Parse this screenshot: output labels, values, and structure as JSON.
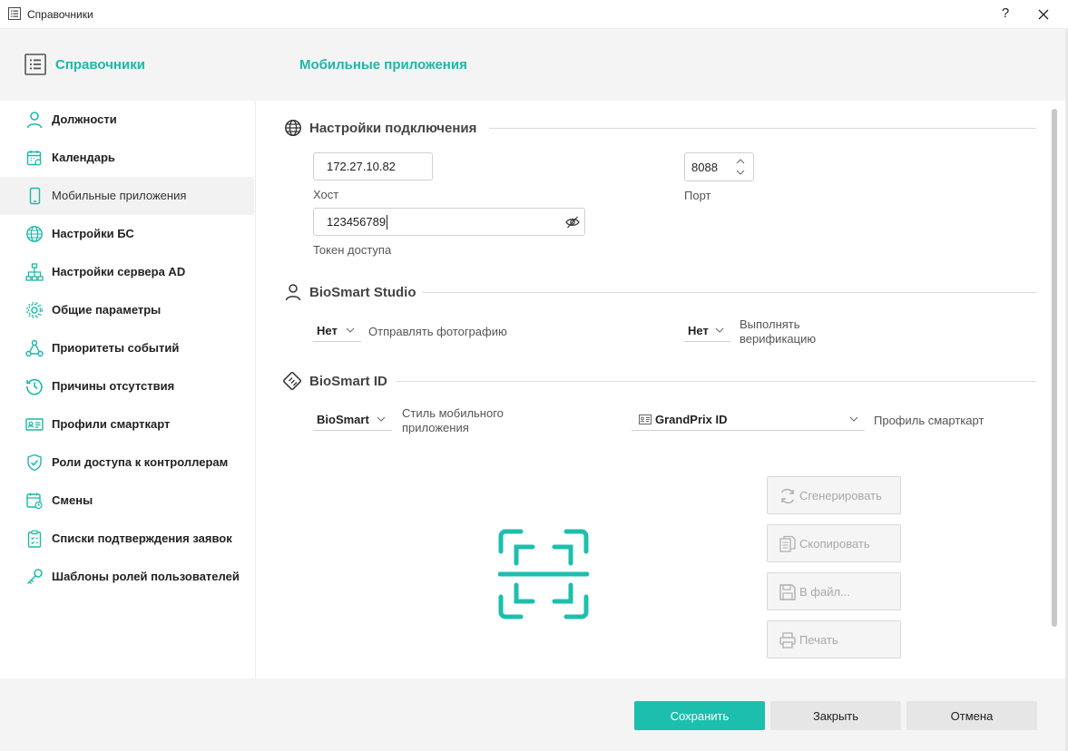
{
  "window": {
    "title": "Справочники",
    "help_label": "?"
  },
  "header": {
    "section_title": "Справочники",
    "page_title": "Мобильные приложения"
  },
  "sidebar": {
    "items": [
      {
        "label": "Должности",
        "icon": "person-icon"
      },
      {
        "label": "Календарь",
        "icon": "calendar-icon"
      },
      {
        "label": "Мобильные приложения",
        "icon": "mobile-phone-icon",
        "active": true
      },
      {
        "label": "Настройки БС",
        "icon": "globe-icon"
      },
      {
        "label": "Настройки сервера AD",
        "icon": "network-tree-icon"
      },
      {
        "label": "Общие параметры",
        "icon": "gear-icon"
      },
      {
        "label": "Приоритеты событий",
        "icon": "hierarchy-icon"
      },
      {
        "label": "Причины отсутствия",
        "icon": "history-icon"
      },
      {
        "label": "Профили смарткарт",
        "icon": "id-card-icon"
      },
      {
        "label": "Роли доступа к контроллерам",
        "icon": "shield-check-icon"
      },
      {
        "label": "Смены",
        "icon": "calendar-clock-icon"
      },
      {
        "label": "Списки подтверждения заявок",
        "icon": "clipboard-check-icon"
      },
      {
        "label": "Шаблоны ролей пользователей",
        "icon": "key-icon"
      }
    ]
  },
  "connection": {
    "title": "Настройки подключения",
    "host_value": "172.27.10.82",
    "host_label": "Хост",
    "port_value": "8088",
    "port_label": "Порт",
    "token_value": "123456789",
    "token_label": "Токен доступа"
  },
  "studio": {
    "title": "BioSmart Studio",
    "send_photo_value": "Нет",
    "send_photo_label": "Отправлять фотографию",
    "verify_value": "Нет",
    "verify_label_1": "Выполнять",
    "verify_label_2": "верификацию"
  },
  "bioid": {
    "title": "BioSmart ID",
    "style_value": "BioSmart",
    "style_label_1": "Стиль мобильного",
    "style_label_2": "приложения",
    "profile_value": "GrandPrix ID",
    "profile_label": "Профиль смарткарт"
  },
  "actions": {
    "generate": "Сгенерировать",
    "copy": "Скопировать",
    "to_file": "В файл...",
    "print": "Печать"
  },
  "footer": {
    "save": "Сохранить",
    "close": "Закрыть",
    "cancel": "Отмена"
  },
  "colors": {
    "accent": "#1cb8a8",
    "primary_button": "#1cbfad"
  }
}
